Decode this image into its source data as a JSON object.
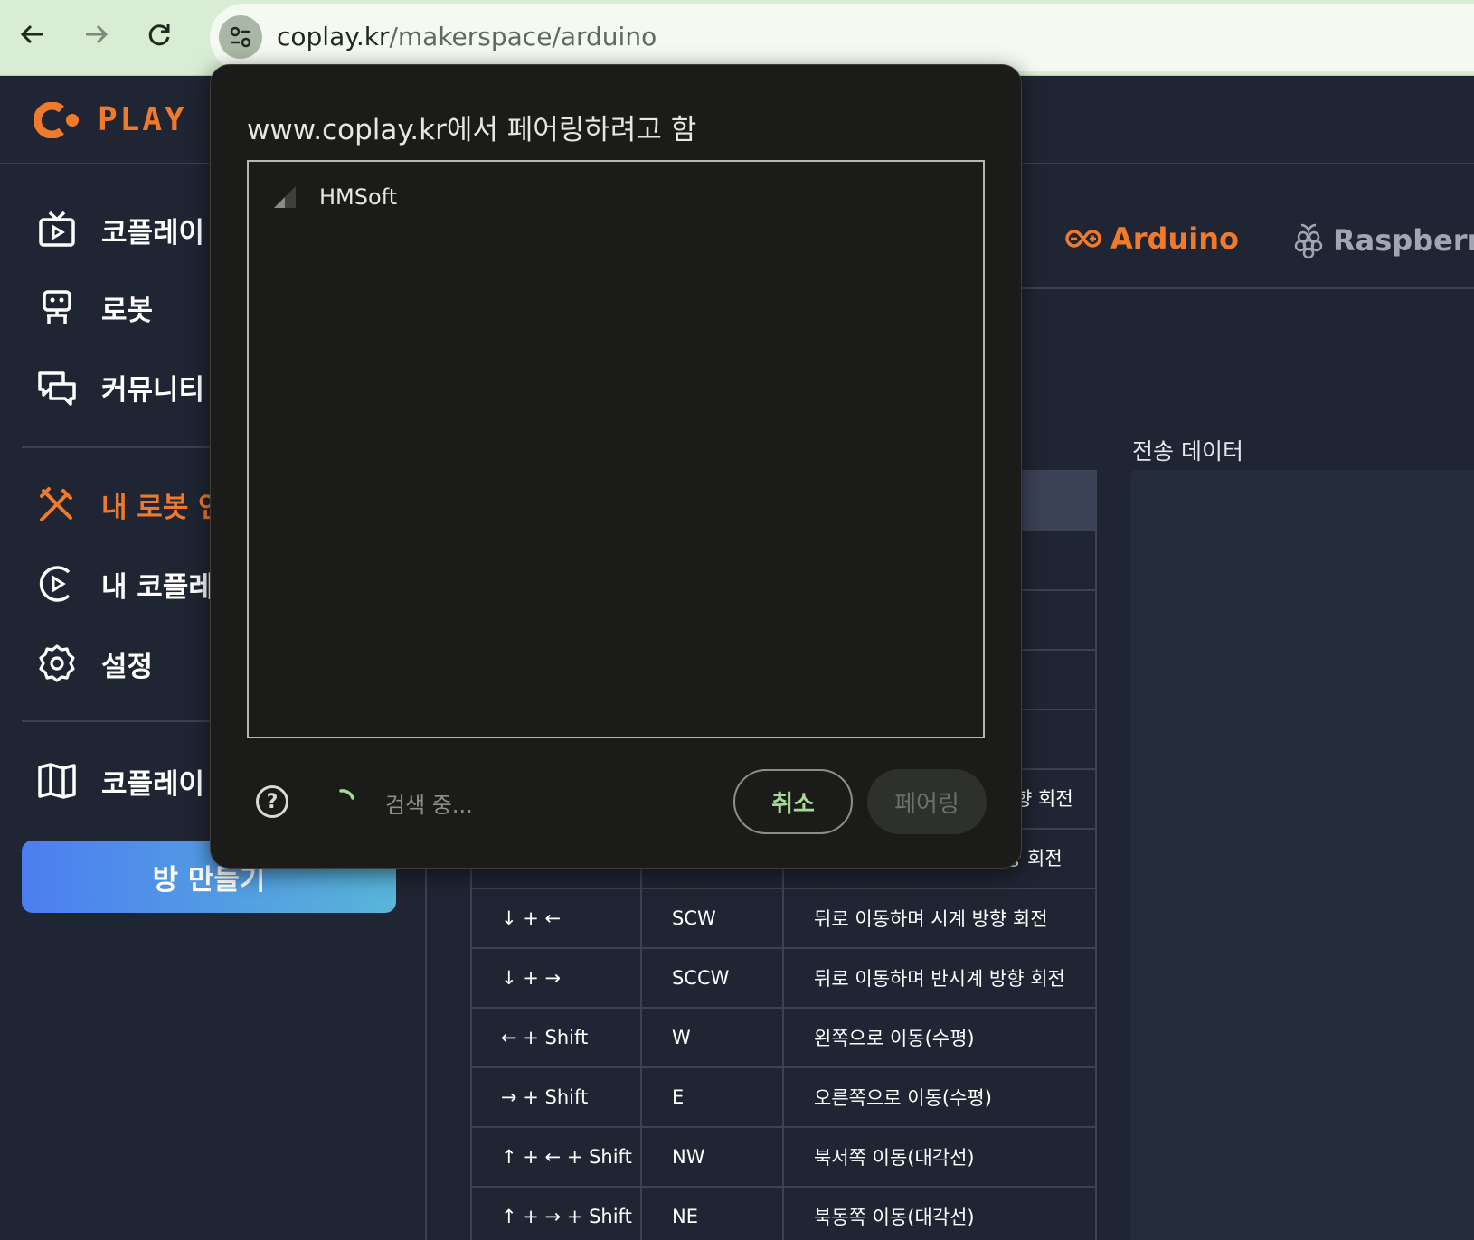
{
  "browser": {
    "url_host": "coplay.kr",
    "url_path": "/makerspace/arduino"
  },
  "logo": {
    "text": "PLAY",
    "color": "#f07a2c"
  },
  "sidebar": {
    "items": [
      {
        "label": "코플레이",
        "icon": "tv-icon"
      },
      {
        "label": "로봇",
        "icon": "robot-icon"
      },
      {
        "label": "커뮤니티",
        "icon": "chat-icon"
      },
      {
        "label": "내 로봇 연",
        "icon": "tools-icon",
        "active": true
      },
      {
        "label": "내 코플레",
        "icon": "coplay-circle-icon"
      },
      {
        "label": "설정",
        "icon": "gear-icon"
      },
      {
        "label": "코플레이",
        "icon": "book-icon"
      }
    ],
    "create_room": "방 만들기"
  },
  "tabs": [
    {
      "label": "Arduino",
      "active": true
    },
    {
      "label": "Raspberry",
      "active": false
    }
  ],
  "send_data_label": "전송 데이터",
  "table": {
    "partial_rows": [
      "향 회전",
      "향 회전"
    ],
    "rows": [
      {
        "key": "↓ + ←",
        "code": "SCW",
        "desc": "뒤로 이동하며 시계 방향 회전"
      },
      {
        "key": "↓ + →",
        "code": "SCCW",
        "desc": "뒤로 이동하며 반시계 방향 회전"
      },
      {
        "key": "← + Shift",
        "code": "W",
        "desc": "왼쪽으로 이동(수평)"
      },
      {
        "key": "→ + Shift",
        "code": "E",
        "desc": "오른쪽으로 이동(수평)"
      },
      {
        "key": "↑ + ← + Shift",
        "code": "NW",
        "desc": "북서쪽 이동(대각선)"
      },
      {
        "key": "↑ + → + Shift",
        "code": "NE",
        "desc": "북동쪽 이동(대각선)"
      }
    ]
  },
  "dialog": {
    "title": "www.coplay.kr에서 페어링하려고 함",
    "devices": [
      {
        "name": "HMSoft",
        "icon": "signal-strength-icon"
      }
    ],
    "status": "검색 중...",
    "help": "?",
    "cancel": "취소",
    "pair": "페어링",
    "accent": "#a8d89a"
  }
}
